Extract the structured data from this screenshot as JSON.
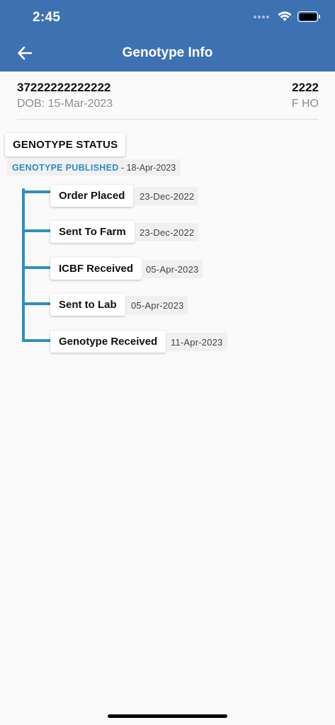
{
  "status_bar": {
    "time": "2:45"
  },
  "header": {
    "title": "Genotype Info",
    "back_icon": "arrow-left-icon"
  },
  "animal": {
    "tag": "37222222222222",
    "dob": "DOB: 15-Mar-2023",
    "herd_number": "2222",
    "breed": "F HO"
  },
  "genotype": {
    "status_label": "GENOTYPE STATUS",
    "published_label": "GENOTYPE PUBLISHED",
    "published_date": " - 18-Apr-2023",
    "steps": [
      {
        "label": "Order Placed",
        "date": "23-Dec-2022"
      },
      {
        "label": "Sent To Farm",
        "date": "23-Dec-2022"
      },
      {
        "label": "ICBF Received",
        "date": "05-Apr-2023"
      },
      {
        "label": "Sent to Lab",
        "date": "05-Apr-2023"
      },
      {
        "label": "Genotype Received",
        "date": "11-Apr-2023"
      }
    ]
  },
  "colors": {
    "header": "#3d71b1",
    "accent": "#2f8fc0",
    "background": "#fafafa"
  }
}
